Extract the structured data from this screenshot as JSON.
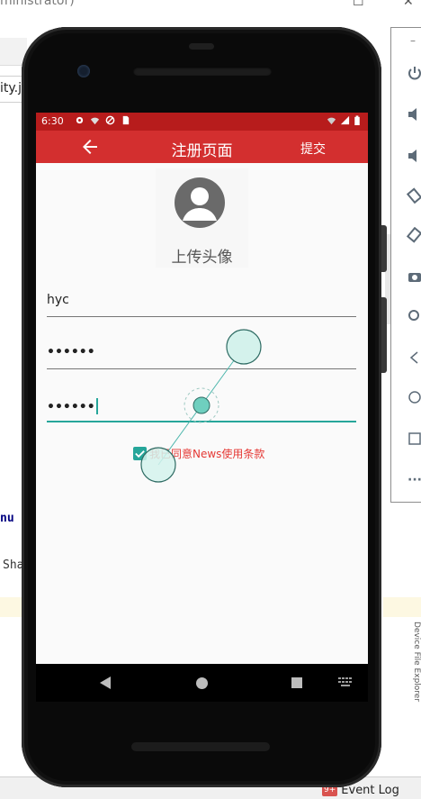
{
  "ide": {
    "window_title": "ministrator)",
    "file_tab": "ity.j",
    "code_line_1": "nu",
    "code_line_2": "Sha",
    "event_badge": "9+",
    "event_log": "Event Log",
    "vertical_text": "Device File Explorer"
  },
  "status_bar": {
    "time": "6:30"
  },
  "app_bar": {
    "title": "注册页面",
    "submit_label": "提交"
  },
  "avatar": {
    "upload_label": "上传头像"
  },
  "form": {
    "username": "hyc",
    "password": "••••••",
    "confirm_password": "••••••",
    "agree_label": "我已同意News使用条款",
    "agree_checked": true
  },
  "colors": {
    "appbar": "#d32f2f",
    "statusbar": "#b71c1c",
    "accent": "#26a69a",
    "agree_text": "#e53935"
  }
}
